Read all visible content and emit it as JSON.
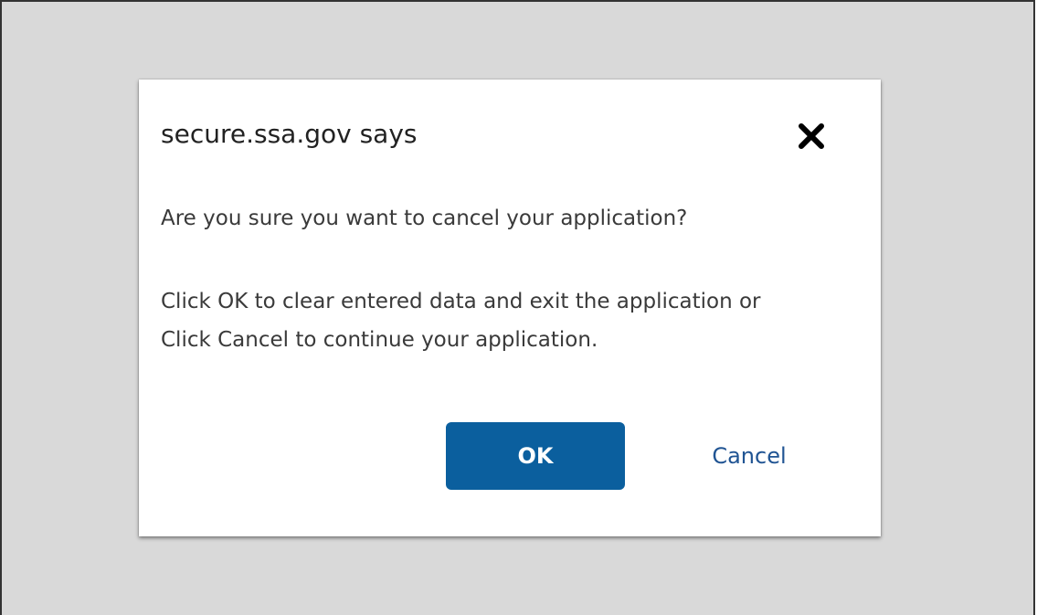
{
  "dialog": {
    "title": "secure.ssa.gov says",
    "close_icon": "close-icon",
    "question": "Are you sure you want to cancel your application?",
    "instructions": "Click OK to clear entered data and exit the application or Click Cancel to continue your application.",
    "ok_label": "OK",
    "cancel_label": "Cancel"
  },
  "colors": {
    "backdrop": "#d9d9d9",
    "dialog_background": "#ffffff",
    "ok_button": "#0b5f9e",
    "cancel_link": "#205493",
    "text": "#3a3a3a"
  }
}
